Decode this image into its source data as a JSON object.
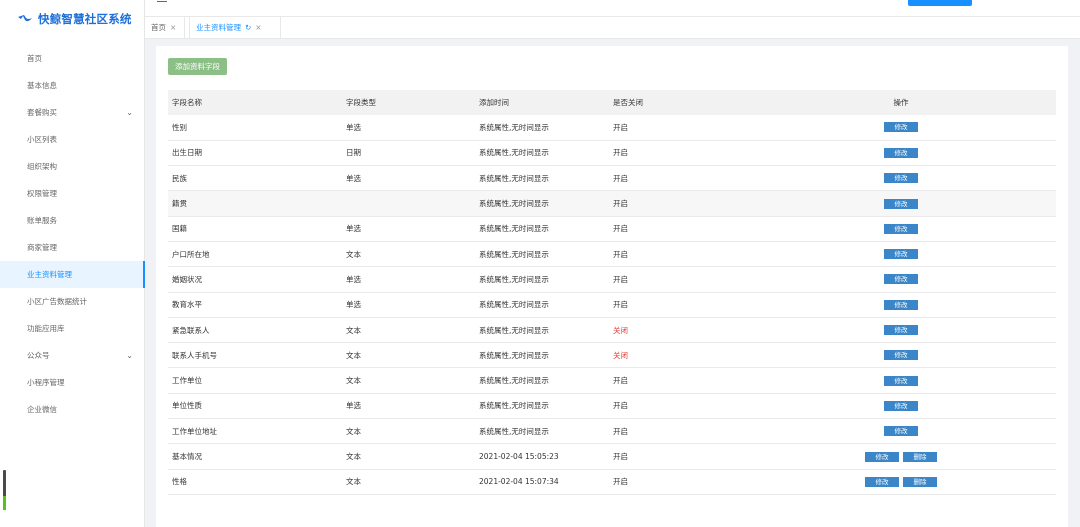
{
  "app": {
    "title": "快鲸智慧社区系统"
  },
  "sidebar": {
    "items": [
      {
        "label": "首页"
      },
      {
        "label": "基本信息"
      },
      {
        "label": "套餐购买",
        "expandable": true
      },
      {
        "label": "小区列表"
      },
      {
        "label": "组织架构"
      },
      {
        "label": "权限管理"
      },
      {
        "label": "账单服务"
      },
      {
        "label": "商家管理"
      },
      {
        "label": "业主资料管理",
        "active": true
      },
      {
        "label": "小区广告数据统计"
      },
      {
        "label": "功能应用库"
      },
      {
        "label": "公众号",
        "expandable": true
      },
      {
        "label": "小程序管理"
      },
      {
        "label": "企业微信"
      }
    ]
  },
  "tabs": {
    "home": "首页",
    "active": "业主资料管理"
  },
  "toolbar": {
    "add_label": "添加资料字段"
  },
  "table": {
    "headers": [
      "字段名称",
      "字段类型",
      "添加时间",
      "是否关闭",
      "操作"
    ],
    "edit_label": "修改",
    "delete_label": "删除",
    "rows": [
      {
        "name": "性别",
        "type": "单选",
        "time": "系统属性,无时间显示",
        "status": "开启",
        "closed": false,
        "deletable": false
      },
      {
        "name": "出生日期",
        "type": "日期",
        "time": "系统属性,无时间显示",
        "status": "开启",
        "closed": false,
        "deletable": false
      },
      {
        "name": "民族",
        "type": "单选",
        "time": "系统属性,无时间显示",
        "status": "开启",
        "closed": false,
        "deletable": false
      },
      {
        "name": "籍贯",
        "type": "",
        "time": "系统属性,无时间显示",
        "status": "开启",
        "closed": false,
        "deletable": false
      },
      {
        "name": "国籍",
        "type": "单选",
        "time": "系统属性,无时间显示",
        "status": "开启",
        "closed": false,
        "deletable": false
      },
      {
        "name": "户口所在地",
        "type": "文本",
        "time": "系统属性,无时间显示",
        "status": "开启",
        "closed": false,
        "deletable": false
      },
      {
        "name": "婚姻状况",
        "type": "单选",
        "time": "系统属性,无时间显示",
        "status": "开启",
        "closed": false,
        "deletable": false
      },
      {
        "name": "教育水平",
        "type": "单选",
        "time": "系统属性,无时间显示",
        "status": "开启",
        "closed": false,
        "deletable": false
      },
      {
        "name": "紧急联系人",
        "type": "文本",
        "time": "系统属性,无时间显示",
        "status": "关闭",
        "closed": true,
        "deletable": false
      },
      {
        "name": "联系人手机号",
        "type": "文本",
        "time": "系统属性,无时间显示",
        "status": "关闭",
        "closed": true,
        "deletable": false
      },
      {
        "name": "工作单位",
        "type": "文本",
        "time": "系统属性,无时间显示",
        "status": "开启",
        "closed": false,
        "deletable": false
      },
      {
        "name": "单位性质",
        "type": "单选",
        "time": "系统属性,无时间显示",
        "status": "开启",
        "closed": false,
        "deletable": false
      },
      {
        "name": "工作单位地址",
        "type": "文本",
        "time": "系统属性,无时间显示",
        "status": "开启",
        "closed": false,
        "deletable": false
      },
      {
        "name": "基本情况",
        "type": "文本",
        "time": "2021-02-04 15:05:23",
        "status": "开启",
        "closed": false,
        "deletable": true
      },
      {
        "name": "性格",
        "type": "文本",
        "time": "2021-02-04 15:07:34",
        "status": "开启",
        "closed": false,
        "deletable": true
      }
    ]
  }
}
